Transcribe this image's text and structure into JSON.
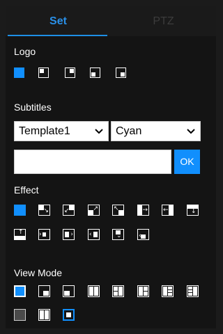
{
  "tabs": {
    "set_label": "Set",
    "ptz_label": "PTZ"
  },
  "logo": {
    "title": "Logo",
    "positions": [
      "none",
      "top-left",
      "top-right",
      "bottom-left",
      "bottom-right"
    ],
    "selected": "none"
  },
  "subtitles": {
    "title": "Subtitles",
    "template_value": "Template1",
    "color_value": "Cyan",
    "text_value": "",
    "ok_label": "OK"
  },
  "effect": {
    "title": "Effect",
    "selected": "none",
    "items": [
      "none",
      "slide-down-right",
      "slide-up-right",
      "slide-down-left",
      "slide-up-left",
      "push-right",
      "push-left",
      "push-down",
      "push-up",
      "box-in",
      "push-in-right",
      "push-in-left",
      "drop-down",
      "reveal-up"
    ]
  },
  "view_mode": {
    "title": "View Mode",
    "items": [
      "normal",
      "pip-bottom-right",
      "pip-bottom-left",
      "split-vertical",
      "split-left-two",
      "split-center",
      "split-right-two",
      "split-three-col",
      "grey-frame",
      "side-by-side",
      "pip-center"
    ],
    "selected": "pip-center"
  },
  "colors": {
    "accent": "#118ffd",
    "background": "#141414",
    "tab_active": "#2a90e8"
  }
}
